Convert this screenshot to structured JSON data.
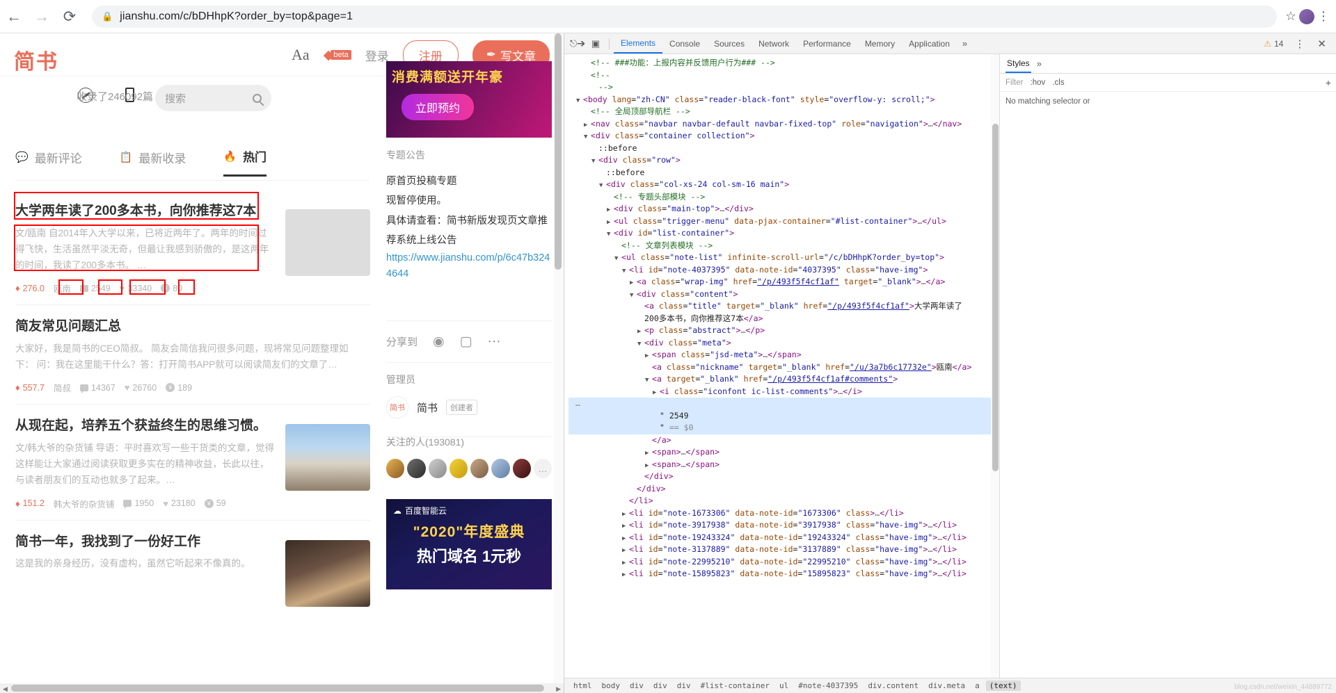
{
  "browser": {
    "back_icon": "←",
    "forward_icon": "→",
    "reload_icon": "⟳",
    "lock_icon": "🔒",
    "url": "jianshu.com/c/bDHhpK?order_by=top&page=1",
    "star_icon": "☆",
    "menu_icon": "⋮"
  },
  "site": {
    "logo": "简书",
    "font_size_icon": "Aa",
    "diamond_icon": "◆",
    "beta_tag": "beta",
    "login": "登录",
    "signup": "注册",
    "write": "写文章",
    "write_icon": "✒",
    "collection_stat": "收录了246092篇",
    "compass_icon": "compass-icon",
    "phone_icon": "phone-icon",
    "search_placeholder": "搜索",
    "search_icon": "search-icon"
  },
  "tabs": [
    {
      "icon": "comment-icon",
      "label": "最新评论",
      "active": false
    },
    {
      "icon": "list-icon",
      "label": "最新收录",
      "active": false
    },
    {
      "icon": "fire-icon",
      "label": "热门",
      "active": true
    }
  ],
  "notes": [
    {
      "title": "大学两年读了200多本书，向你推荐这7本",
      "abstract": "文/瓯南 自2014年入大学以来，已将近两年了。两年的时间过得飞快，生活虽然平淡无奇，但最让我感到骄傲的，是这两年的时间，我读了200多本书。 …",
      "diamond": "276.0",
      "author": "瓯南",
      "comments": "2549",
      "likes": "33340",
      "rewards": "80",
      "has_thumb": true
    },
    {
      "title": "简友常见问题汇总",
      "abstract": "大家好，我是简书的CEO简叔。 简友会简信我问很多问题，现将常见问题整理如下： 问：我在这里能干什么？答：打开简书APP就可以阅读简友们的文章了…",
      "diamond": "557.7",
      "author": "简叔",
      "comments": "14367",
      "likes": "26760",
      "rewards": "189",
      "has_thumb": false
    },
    {
      "title": "从现在起，培养五个获益终生的思维习惯。",
      "abstract": "文/韩大爷的杂货铺 导语：平时喜欢写一些干货类的文章，觉得这样能让大家通过阅读获取更多实在的精神收益，长此以往，与读者朋友们的互动也就多了起来。…",
      "diamond": "151.2",
      "author": "韩大爷的杂货铺",
      "comments": "1950",
      "likes": "23180",
      "rewards": "59",
      "has_thumb": true
    },
    {
      "title": "简书一年，我找到了一份好工作",
      "abstract": "这是我的亲身经历，没有虚构，虽然它听起来不像真的。",
      "diamond": "",
      "author": "",
      "comments": "",
      "likes": "",
      "rewards": "",
      "has_thumb": true
    }
  ],
  "sidebar": {
    "ad1_title": "消费满额送开年豪",
    "ad1_button": "立即预约",
    "notice_label": "专题公告",
    "notice_l1": "原首页投稿专题",
    "notice_l2": "现暂停使用。",
    "notice_l3": "具体请查看：简书新版发现页文章推荐系统上线公告",
    "notice_link": "https://www.jianshu.com/p/6c47b3244644",
    "share_label": "分享到",
    "share_weibo_icon": "weibo-icon",
    "share_wechat_icon": "wechat-icon",
    "share_more_icon": "more-icon",
    "admin_label": "管理员",
    "admin_avatar_text": "简书",
    "admin_name": "简书",
    "admin_badge": "创建者",
    "followers_label": "关注的人(193081)",
    "followers_more": "…",
    "ad2_brand": "百度智能云",
    "ad2_year": "\"2020\"年度盛典",
    "ad2_line": "热门域名 1元秒",
    "ad2_highlight": "1"
  },
  "devtools": {
    "inspect_icon": "inspect-icon",
    "device_icon": "device-toolbar-icon",
    "tabs": [
      {
        "label": "Elements",
        "active": true
      },
      {
        "label": "Console",
        "active": false
      },
      {
        "label": "Sources",
        "active": false
      },
      {
        "label": "Network",
        "active": false
      },
      {
        "label": "Performance",
        "active": false
      },
      {
        "label": "Memory",
        "active": false
      },
      {
        "label": "Application",
        "active": false
      }
    ],
    "more_tabs_icon": "»",
    "warning_icon": "⚠",
    "warning_count": "14",
    "settings_icon": "⋮",
    "close_icon": "✕",
    "dom_lines": [
      {
        "indent": 2,
        "tw": "",
        "html": "<span class=\"cmt\">&lt;!-- ###功能：上报内容并反馈用户行为### --&gt;</span>"
      },
      {
        "indent": 2,
        "tw": "",
        "html": "<span class=\"cmt\">&lt;!--</span>"
      },
      {
        "indent": 3,
        "tw": "",
        "html": "<span class=\"cmt\">--&gt;</span>"
      },
      {
        "indent": 1,
        "tw": "▼",
        "html": "<span class=\"punc\">&lt;</span><span class=\"tag\">body</span> <span class=\"attr\">lang</span>=<span class=\"val\">\"zh-CN\"</span> <span class=\"attr\">class</span>=<span class=\"val\">\"reader-black-font\"</span> <span class=\"attr\">style</span>=<span class=\"val\">\"overflow-y: scroll;\"</span><span class=\"punc\">&gt;</span>"
      },
      {
        "indent": 2,
        "tw": "",
        "html": "<span class=\"cmt\">&lt;!-- 全局顶部导航栏 --&gt;</span>"
      },
      {
        "indent": 2,
        "tw": "▶",
        "html": "<span class=\"punc\">&lt;</span><span class=\"tag\">nav</span> <span class=\"attr\">class</span>=<span class=\"val\">\"navbar navbar-default navbar-fixed-top\"</span> <span class=\"attr\">role</span>=<span class=\"val\">\"navigation\"</span><span class=\"punc\">&gt;</span><span class=\"dots\">…</span><span class=\"punc\">&lt;/</span><span class=\"tag\">nav</span><span class=\"punc\">&gt;</span>"
      },
      {
        "indent": 2,
        "tw": "▼",
        "html": "<span class=\"punc\">&lt;</span><span class=\"tag\">div</span> <span class=\"attr\">class</span>=<span class=\"val\">\"container collection\"</span><span class=\"punc\">&gt;</span>"
      },
      {
        "indent": 3,
        "tw": "",
        "html": "<span class=\"txt\">::before</span>"
      },
      {
        "indent": 3,
        "tw": "▼",
        "html": "<span class=\"punc\">&lt;</span><span class=\"tag\">div</span> <span class=\"attr\">class</span>=<span class=\"val\">\"row\"</span><span class=\"punc\">&gt;</span>"
      },
      {
        "indent": 4,
        "tw": "",
        "html": "<span class=\"txt\">::before</span>"
      },
      {
        "indent": 4,
        "tw": "▼",
        "html": "<span class=\"punc\">&lt;</span><span class=\"tag\">div</span> <span class=\"attr\">class</span>=<span class=\"val\">\"col-xs-24 col-sm-16 main\"</span><span class=\"punc\">&gt;</span>"
      },
      {
        "indent": 5,
        "tw": "",
        "html": "<span class=\"cmt\">&lt;!-- 专题头部模块 --&gt;</span>"
      },
      {
        "indent": 5,
        "tw": "▶",
        "html": "<span class=\"punc\">&lt;</span><span class=\"tag\">div</span> <span class=\"attr\">class</span>=<span class=\"val\">\"main-top\"</span><span class=\"punc\">&gt;</span><span class=\"dots\">…</span><span class=\"punc\">&lt;/</span><span class=\"tag\">div</span><span class=\"punc\">&gt;</span>"
      },
      {
        "indent": 5,
        "tw": "▶",
        "html": "<span class=\"punc\">&lt;</span><span class=\"tag\">ul</span> <span class=\"attr\">class</span>=<span class=\"val\">\"trigger-menu\"</span> <span class=\"attr\">data-pjax-container</span>=<span class=\"val\">\"#list-container\"</span><span class=\"punc\">&gt;</span><span class=\"dots\">…</span><span class=\"punc\">&lt;/</span><span class=\"tag\">ul</span><span class=\"punc\">&gt;</span>"
      },
      {
        "indent": 5,
        "tw": "▼",
        "html": "<span class=\"punc\">&lt;</span><span class=\"tag\">div</span> <span class=\"attr\">id</span>=<span class=\"val\">\"list-container\"</span><span class=\"punc\">&gt;</span>"
      },
      {
        "indent": 6,
        "tw": "",
        "html": "<span class=\"cmt\">&lt;!-- 文章列表模块 --&gt;</span>"
      },
      {
        "indent": 6,
        "tw": "▼",
        "html": "<span class=\"punc\">&lt;</span><span class=\"tag\">ul</span> <span class=\"attr\">class</span>=<span class=\"val\">\"note-list\"</span> <span class=\"attr\">infinite-scroll-url</span>=<span class=\"val\">\"/c/bDHhpK?order_by=top\"</span><span class=\"punc\">&gt;</span>"
      },
      {
        "indent": 7,
        "tw": "▼",
        "html": "<span class=\"punc\">&lt;</span><span class=\"tag\">li</span> <span class=\"attr\">id</span>=<span class=\"val\">\"note-4037395\"</span> <span class=\"attr\">data-note-id</span>=<span class=\"val\">\"4037395\"</span> <span class=\"attr\">class</span>=<span class=\"val\">\"have-img\"</span><span class=\"punc\">&gt;</span>"
      },
      {
        "indent": 8,
        "tw": "▶",
        "html": "<span class=\"punc\">&lt;</span><span class=\"tag\">a</span> <span class=\"attr\">class</span>=<span class=\"val\">\"wrap-img\"</span> <span class=\"attr\">href</span>=<span class=\"lnk\">\"/p/493f5f4cf1af\"</span> <span class=\"attr\">target</span>=<span class=\"val\">\"_blank\"</span><span class=\"punc\">&gt;</span><span class=\"dots\">…</span><span class=\"punc\">&lt;/</span><span class=\"tag\">a</span><span class=\"punc\">&gt;</span>"
      },
      {
        "indent": 8,
        "tw": "▼",
        "html": "<span class=\"punc\">&lt;</span><span class=\"tag\">div</span> <span class=\"attr\">class</span>=<span class=\"val\">\"content\"</span><span class=\"punc\">&gt;</span>"
      },
      {
        "indent": 9,
        "tw": "",
        "html": "<span class=\"punc\">&lt;</span><span class=\"tag\">a</span> <span class=\"attr\">class</span>=<span class=\"val\">\"title\"</span> <span class=\"attr\">target</span>=<span class=\"val\">\"_blank\"</span> <span class=\"attr\">href</span>=<span class=\"lnk\">\"/p/493f5f4cf1af\"</span><span class=\"punc\">&gt;</span><span class=\"txt\">大学两年读了</span>"
      },
      {
        "indent": 9,
        "tw": "",
        "html": "<span class=\"txt\">200多本书，向你推荐这7本</span><span class=\"punc\">&lt;/</span><span class=\"tag\">a</span><span class=\"punc\">&gt;</span>"
      },
      {
        "indent": 9,
        "tw": "▶",
        "html": "<span class=\"punc\">&lt;</span><span class=\"tag\">p</span> <span class=\"attr\">class</span>=<span class=\"val\">\"abstract\"</span><span class=\"punc\">&gt;</span><span class=\"dots\">…</span><span class=\"punc\">&lt;/</span><span class=\"tag\">p</span><span class=\"punc\">&gt;</span>"
      },
      {
        "indent": 9,
        "tw": "▼",
        "html": "<span class=\"punc\">&lt;</span><span class=\"tag\">div</span> <span class=\"attr\">class</span>=<span class=\"val\">\"meta\"</span><span class=\"punc\">&gt;</span>"
      },
      {
        "indent": 10,
        "tw": "▶",
        "html": "<span class=\"punc\">&lt;</span><span class=\"tag\">span</span> <span class=\"attr\">class</span>=<span class=\"val\">\"jsd-meta\"</span><span class=\"punc\">&gt;</span><span class=\"dots\">…</span><span class=\"punc\">&lt;/</span><span class=\"tag\">span</span><span class=\"punc\">&gt;</span>"
      },
      {
        "indent": 10,
        "tw": "",
        "html": "<span class=\"punc\">&lt;</span><span class=\"tag\">a</span> <span class=\"attr\">class</span>=<span class=\"val\">\"nickname\"</span> <span class=\"attr\">target</span>=<span class=\"val\">\"_blank\"</span> <span class=\"attr\">href</span>=<span class=\"lnk\">\"/u/3a7b6c17732e\"</span><span class=\"punc\">&gt;</span><span class=\"txt\">瓯南</span><span class=\"punc\">&lt;/</span><span class=\"tag\">a</span><span class=\"punc\">&gt;</span>"
      },
      {
        "indent": 10,
        "tw": "▼",
        "html": "<span class=\"punc\">&lt;</span><span class=\"tag\">a</span> <span class=\"attr\">target</span>=<span class=\"val\">\"_blank\"</span> <span class=\"attr\">href</span>=<span class=\"lnk\">\"/p/493f5f4cf1af#comments\"</span><span class=\"punc\">&gt;</span>"
      },
      {
        "indent": 11,
        "tw": "▶",
        "html": "<span class=\"punc\">&lt;</span><span class=\"tag\">i</span> <span class=\"attr\">class</span>=<span class=\"val\">\"iconfont ic-list-comments\"</span><span class=\"punc\">&gt;</span><span class=\"dots\">…</span><span class=\"punc\">&lt;/</span><span class=\"tag\">i</span><span class=\"punc\">&gt;</span>"
      },
      {
        "indent": 0,
        "tw": "",
        "sel": true,
        "html": "<span class=\"sel-badge\">…</span>"
      },
      {
        "indent": 11,
        "tw": "",
        "sel": true,
        "html": "<span class=\"txt\">\" 2549</span>"
      },
      {
        "indent": 11,
        "tw": "",
        "sel": true,
        "html": "<span class=\"txt\">\"</span> <span class=\"sel-badge\">== $0</span>"
      },
      {
        "indent": 10,
        "tw": "",
        "html": "<span class=\"punc\">&lt;/</span><span class=\"tag\">a</span><span class=\"punc\">&gt;</span>"
      },
      {
        "indent": 10,
        "tw": "▶",
        "html": "<span class=\"punc\">&lt;</span><span class=\"tag\">span</span><span class=\"punc\">&gt;</span><span class=\"dots\">…</span><span class=\"punc\">&lt;/</span><span class=\"tag\">span</span><span class=\"punc\">&gt;</span>"
      },
      {
        "indent": 10,
        "tw": "▶",
        "html": "<span class=\"punc\">&lt;</span><span class=\"tag\">span</span><span class=\"punc\">&gt;</span><span class=\"dots\">…</span><span class=\"punc\">&lt;/</span><span class=\"tag\">span</span><span class=\"punc\">&gt;</span>"
      },
      {
        "indent": 9,
        "tw": "",
        "html": "<span class=\"punc\">&lt;/</span><span class=\"tag\">div</span><span class=\"punc\">&gt;</span>"
      },
      {
        "indent": 8,
        "tw": "",
        "html": "<span class=\"punc\">&lt;/</span><span class=\"tag\">div</span><span class=\"punc\">&gt;</span>"
      },
      {
        "indent": 7,
        "tw": "",
        "html": "<span class=\"punc\">&lt;/</span><span class=\"tag\">li</span><span class=\"punc\">&gt;</span>"
      },
      {
        "indent": 7,
        "tw": "▶",
        "html": "<span class=\"punc\">&lt;</span><span class=\"tag\">li</span> <span class=\"attr\">id</span>=<span class=\"val\">\"note-1673306\"</span> <span class=\"attr\">data-note-id</span>=<span class=\"val\">\"1673306\"</span> <span class=\"attr\">class</span><span class=\"punc\">&gt;</span><span class=\"dots\">…</span><span class=\"punc\">&lt;/</span><span class=\"tag\">li</span><span class=\"punc\">&gt;</span>"
      },
      {
        "indent": 7,
        "tw": "▶",
        "html": "<span class=\"punc\">&lt;</span><span class=\"tag\">li</span> <span class=\"attr\">id</span>=<span class=\"val\">\"note-3917938\"</span> <span class=\"attr\">data-note-id</span>=<span class=\"val\">\"3917938\"</span> <span class=\"attr\">class</span>=<span class=\"val\">\"have-img\"</span><span class=\"punc\">&gt;</span><span class=\"dots\">…</span><span class=\"punc\">&lt;/</span><span class=\"tag\">li</span><span class=\"punc\">&gt;</span>"
      },
      {
        "indent": 7,
        "tw": "▶",
        "html": "<span class=\"punc\">&lt;</span><span class=\"tag\">li</span> <span class=\"attr\">id</span>=<span class=\"val\">\"note-19243324\"</span> <span class=\"attr\">data-note-id</span>=<span class=\"val\">\"19243324\"</span> <span class=\"attr\">class</span>=<span class=\"val\">\"have-img\"</span><span class=\"punc\">&gt;</span><span class=\"dots\">…</span><span class=\"punc\">&lt;/</span><span class=\"tag\">li</span><span class=\"punc\">&gt;</span>"
      },
      {
        "indent": 7,
        "tw": "▶",
        "html": "<span class=\"punc\">&lt;</span><span class=\"tag\">li</span> <span class=\"attr\">id</span>=<span class=\"val\">\"note-3137889\"</span> <span class=\"attr\">data-note-id</span>=<span class=\"val\">\"3137889\"</span> <span class=\"attr\">class</span>=<span class=\"val\">\"have-img\"</span><span class=\"punc\">&gt;</span><span class=\"dots\">…</span><span class=\"punc\">&lt;/</span><span class=\"tag\">li</span><span class=\"punc\">&gt;</span>"
      },
      {
        "indent": 7,
        "tw": "▶",
        "html": "<span class=\"punc\">&lt;</span><span class=\"tag\">li</span> <span class=\"attr\">id</span>=<span class=\"val\">\"note-22995210\"</span> <span class=\"attr\">data-note-id</span>=<span class=\"val\">\"22995210\"</span> <span class=\"attr\">class</span>=<span class=\"val\">\"have-img\"</span><span class=\"punc\">&gt;</span><span class=\"dots\">…</span><span class=\"punc\">&lt;/</span><span class=\"tag\">li</span><span class=\"punc\">&gt;</span>"
      },
      {
        "indent": 7,
        "tw": "▶",
        "html": "<span class=\"punc\">&lt;</span><span class=\"tag\">li</span> <span class=\"attr\">id</span>=<span class=\"val\">\"note-15895823\"</span> <span class=\"attr\">data-note-id</span>=<span class=\"val\">\"15895823\"</span> <span class=\"attr\">class</span>=<span class=\"val\">\"have-img\"</span><span class=\"punc\">&gt;</span><span class=\"dots\">…</span><span class=\"punc\">&lt;/</span><span class=\"tag\">li</span><span class=\"punc\">&gt;</span>"
      }
    ],
    "styles": {
      "title": "Styles",
      "more_icon": "»",
      "filter_placeholder": "Filter",
      "hov": ":hov",
      "cls": ".cls",
      "plus": "+",
      "empty_text": "No matching selector or"
    },
    "breadcrumb": [
      "html",
      "body",
      "div",
      "div",
      "div",
      "#list-container",
      "ul",
      "#note-4037395",
      "div.content",
      "div.meta",
      "a",
      "(text)"
    ],
    "watermark": "blog.csdn.net/weixin_44889772"
  }
}
